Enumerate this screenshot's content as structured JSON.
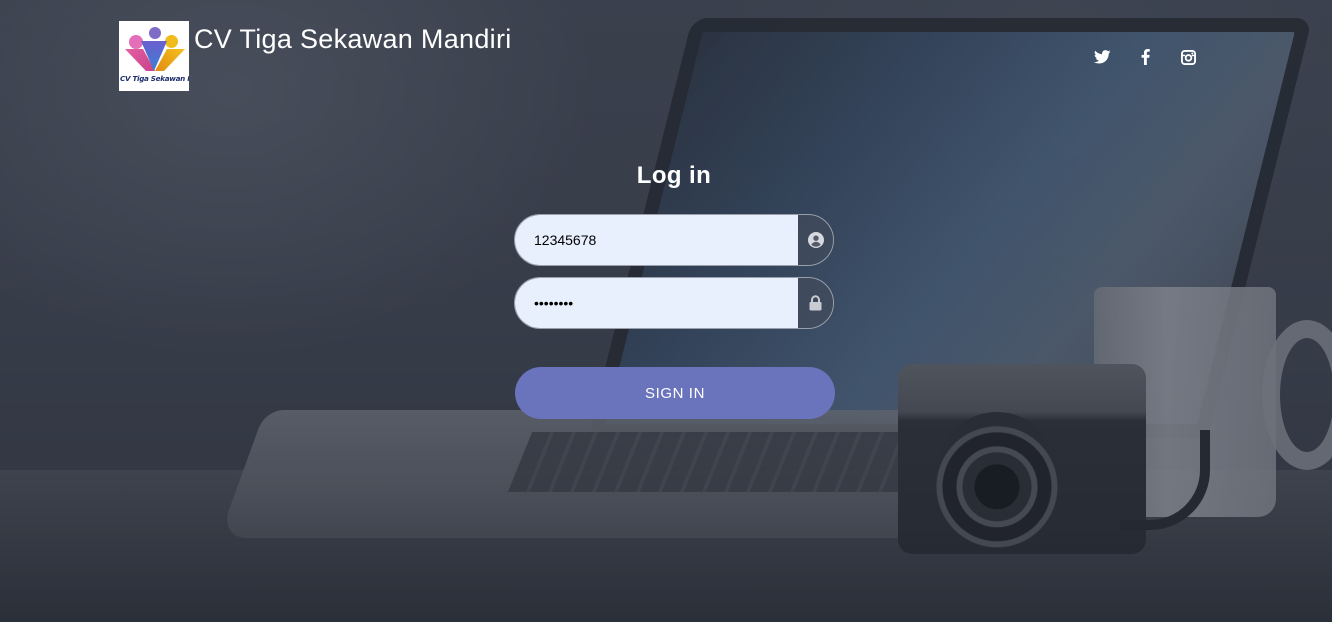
{
  "brand": {
    "name": "CV Tiga Sekawan Mandiri",
    "logo_text": "CV Tiga Sekawan Mandiri"
  },
  "social": [
    {
      "icon": "twitter-icon"
    },
    {
      "icon": "facebook-icon"
    },
    {
      "icon": "instagram-icon"
    }
  ],
  "login": {
    "title": "Log in",
    "username_value": "12345678",
    "password_value": "••••••••",
    "username_icon": "user-circle-icon",
    "password_icon": "lock-icon",
    "submit_label": "SIGN IN"
  },
  "colors": {
    "accent": "#6a74bd",
    "input_bg": "#e8f0fe"
  }
}
